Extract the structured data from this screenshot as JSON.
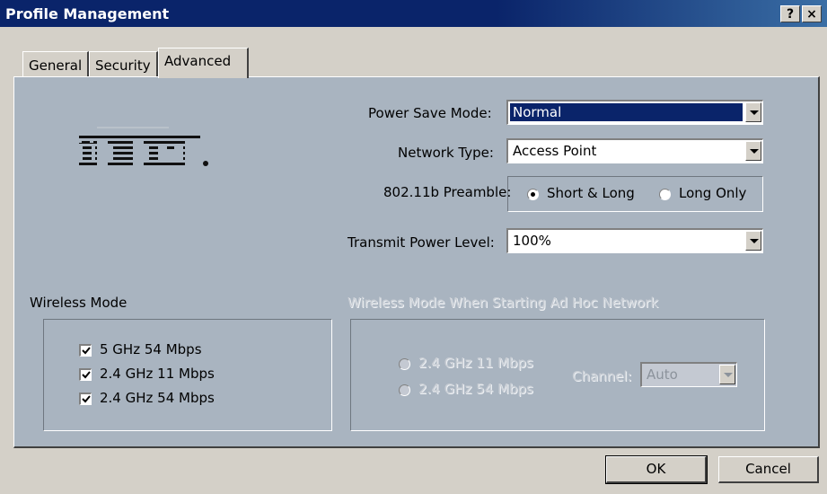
{
  "window": {
    "title": "Profile Management",
    "help_button": "?",
    "close_button": "×"
  },
  "tabs": [
    {
      "label": "General",
      "active": false
    },
    {
      "label": "Security",
      "active": false
    },
    {
      "label": "Advanced",
      "active": true
    }
  ],
  "logo": {
    "text": "IBM"
  },
  "settings": {
    "power_save_mode": {
      "label": "Power Save Mode:",
      "value": "Normal"
    },
    "network_type": {
      "label": "Network Type:",
      "value": "Access Point"
    },
    "preamble": {
      "label": "802.11b Preamble:",
      "options": [
        {
          "label": "Short & Long",
          "checked": true
        },
        {
          "label": "Long Only",
          "checked": false
        }
      ]
    },
    "transmit_power": {
      "label": "Transmit Power Level:",
      "value": "100%"
    }
  },
  "wireless_mode": {
    "title": "Wireless Mode",
    "options": [
      {
        "label": "5 GHz 54 Mbps",
        "checked": true
      },
      {
        "label": "2.4 GHz 11 Mbps",
        "checked": true
      },
      {
        "label": "2.4 GHz 54 Mbps",
        "checked": true
      }
    ]
  },
  "adhoc_mode": {
    "title": "Wireless Mode When Starting Ad Hoc Network",
    "enabled": false,
    "options": [
      {
        "label": "2.4 GHz 11 Mbps",
        "checked": false
      },
      {
        "label": "2.4 GHz 54 Mbps",
        "checked": false
      }
    ],
    "channel": {
      "label": "Channel:",
      "value": "Auto"
    }
  },
  "buttons": {
    "ok": "OK",
    "cancel": "Cancel"
  },
  "colors": {
    "titlebar": "#0a246a",
    "dialog": "#d4d0c8",
    "panel": "#a9b4c0",
    "selection": "#0a246a"
  }
}
